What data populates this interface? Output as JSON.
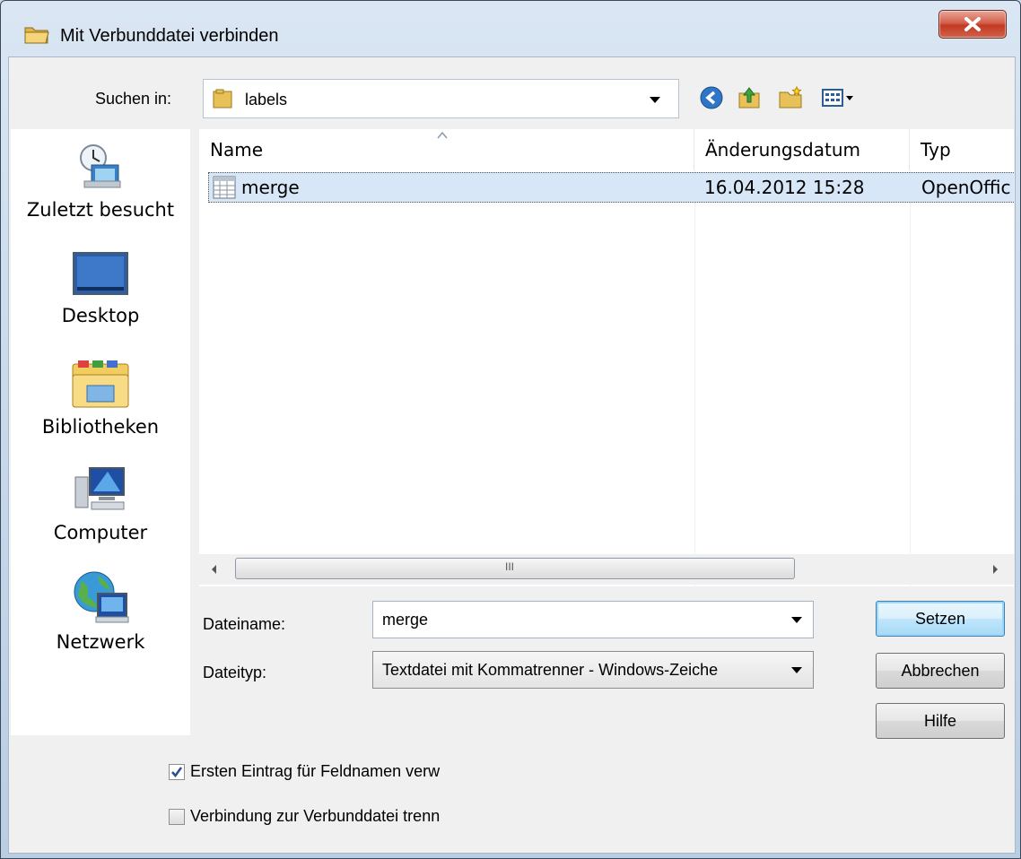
{
  "window": {
    "title": "Mit Verbunddatei verbinden"
  },
  "toolbar": {
    "lookin_label": "Suchen in:",
    "lookin_value": "labels",
    "icons": [
      "back-icon",
      "up-folder-icon",
      "new-folder-icon",
      "view-menu-icon"
    ]
  },
  "places": [
    {
      "label": "Zuletzt besucht",
      "icon": "recent-places-icon"
    },
    {
      "label": "Desktop",
      "icon": "desktop-icon"
    },
    {
      "label": "Bibliotheken",
      "icon": "libraries-icon"
    },
    {
      "label": "Computer",
      "icon": "computer-icon"
    },
    {
      "label": "Netzwerk",
      "icon": "network-icon"
    }
  ],
  "filelist": {
    "columns": [
      "Name",
      "Änderungsdatum",
      "Typ"
    ],
    "rows": [
      {
        "name": "merge",
        "date": "16.04.2012 15:28",
        "type": "OpenOffic"
      }
    ],
    "scroll_grip": "III"
  },
  "form": {
    "filename_label": "Dateiname:",
    "filename_value": "merge",
    "filetype_label": "Dateityp:",
    "filetype_value": "Textdatei mit Kommatrenner  - Windows-Zeiche"
  },
  "buttons": {
    "set": "Setzen",
    "cancel": "Abbrechen",
    "help": "Hilfe"
  },
  "options": [
    {
      "label": "Ersten Eintrag für Feldnamen verw",
      "checked": true
    },
    {
      "label": "Verbindung zur Verbunddatei trenn",
      "checked": false
    }
  ],
  "colors": {
    "selection": "#d7e7f7",
    "close_button": "#c23a22",
    "accent": "#3c7fb1"
  }
}
